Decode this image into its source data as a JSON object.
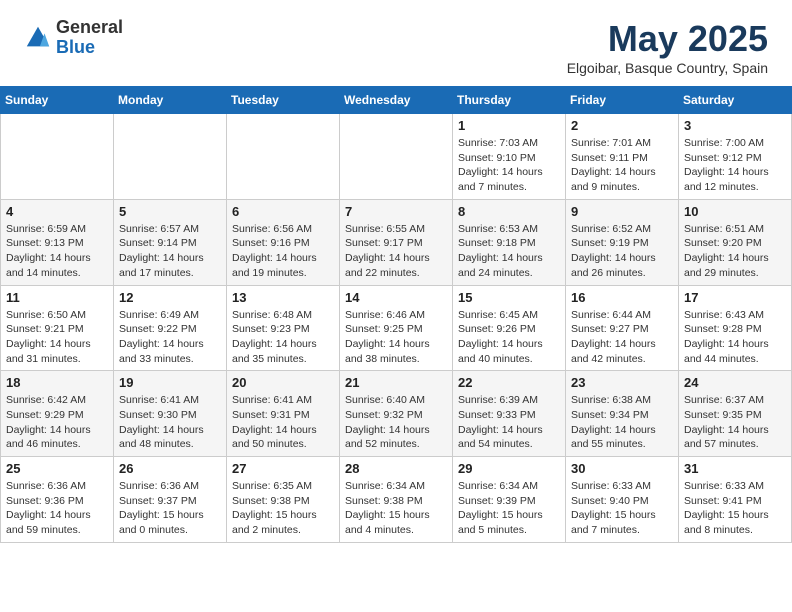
{
  "header": {
    "logo_general": "General",
    "logo_blue": "Blue",
    "title": "May 2025",
    "subtitle": "Elgoibar, Basque Country, Spain"
  },
  "weekdays": [
    "Sunday",
    "Monday",
    "Tuesday",
    "Wednesday",
    "Thursday",
    "Friday",
    "Saturday"
  ],
  "weeks": [
    [
      {
        "day": "",
        "info": ""
      },
      {
        "day": "",
        "info": ""
      },
      {
        "day": "",
        "info": ""
      },
      {
        "day": "",
        "info": ""
      },
      {
        "day": "1",
        "info": "Sunrise: 7:03 AM\nSunset: 9:10 PM\nDaylight: 14 hours\nand 7 minutes."
      },
      {
        "day": "2",
        "info": "Sunrise: 7:01 AM\nSunset: 9:11 PM\nDaylight: 14 hours\nand 9 minutes."
      },
      {
        "day": "3",
        "info": "Sunrise: 7:00 AM\nSunset: 9:12 PM\nDaylight: 14 hours\nand 12 minutes."
      }
    ],
    [
      {
        "day": "4",
        "info": "Sunrise: 6:59 AM\nSunset: 9:13 PM\nDaylight: 14 hours\nand 14 minutes."
      },
      {
        "day": "5",
        "info": "Sunrise: 6:57 AM\nSunset: 9:14 PM\nDaylight: 14 hours\nand 17 minutes."
      },
      {
        "day": "6",
        "info": "Sunrise: 6:56 AM\nSunset: 9:16 PM\nDaylight: 14 hours\nand 19 minutes."
      },
      {
        "day": "7",
        "info": "Sunrise: 6:55 AM\nSunset: 9:17 PM\nDaylight: 14 hours\nand 22 minutes."
      },
      {
        "day": "8",
        "info": "Sunrise: 6:53 AM\nSunset: 9:18 PM\nDaylight: 14 hours\nand 24 minutes."
      },
      {
        "day": "9",
        "info": "Sunrise: 6:52 AM\nSunset: 9:19 PM\nDaylight: 14 hours\nand 26 minutes."
      },
      {
        "day": "10",
        "info": "Sunrise: 6:51 AM\nSunset: 9:20 PM\nDaylight: 14 hours\nand 29 minutes."
      }
    ],
    [
      {
        "day": "11",
        "info": "Sunrise: 6:50 AM\nSunset: 9:21 PM\nDaylight: 14 hours\nand 31 minutes."
      },
      {
        "day": "12",
        "info": "Sunrise: 6:49 AM\nSunset: 9:22 PM\nDaylight: 14 hours\nand 33 minutes."
      },
      {
        "day": "13",
        "info": "Sunrise: 6:48 AM\nSunset: 9:23 PM\nDaylight: 14 hours\nand 35 minutes."
      },
      {
        "day": "14",
        "info": "Sunrise: 6:46 AM\nSunset: 9:25 PM\nDaylight: 14 hours\nand 38 minutes."
      },
      {
        "day": "15",
        "info": "Sunrise: 6:45 AM\nSunset: 9:26 PM\nDaylight: 14 hours\nand 40 minutes."
      },
      {
        "day": "16",
        "info": "Sunrise: 6:44 AM\nSunset: 9:27 PM\nDaylight: 14 hours\nand 42 minutes."
      },
      {
        "day": "17",
        "info": "Sunrise: 6:43 AM\nSunset: 9:28 PM\nDaylight: 14 hours\nand 44 minutes."
      }
    ],
    [
      {
        "day": "18",
        "info": "Sunrise: 6:42 AM\nSunset: 9:29 PM\nDaylight: 14 hours\nand 46 minutes."
      },
      {
        "day": "19",
        "info": "Sunrise: 6:41 AM\nSunset: 9:30 PM\nDaylight: 14 hours\nand 48 minutes."
      },
      {
        "day": "20",
        "info": "Sunrise: 6:41 AM\nSunset: 9:31 PM\nDaylight: 14 hours\nand 50 minutes."
      },
      {
        "day": "21",
        "info": "Sunrise: 6:40 AM\nSunset: 9:32 PM\nDaylight: 14 hours\nand 52 minutes."
      },
      {
        "day": "22",
        "info": "Sunrise: 6:39 AM\nSunset: 9:33 PM\nDaylight: 14 hours\nand 54 minutes."
      },
      {
        "day": "23",
        "info": "Sunrise: 6:38 AM\nSunset: 9:34 PM\nDaylight: 14 hours\nand 55 minutes."
      },
      {
        "day": "24",
        "info": "Sunrise: 6:37 AM\nSunset: 9:35 PM\nDaylight: 14 hours\nand 57 minutes."
      }
    ],
    [
      {
        "day": "25",
        "info": "Sunrise: 6:36 AM\nSunset: 9:36 PM\nDaylight: 14 hours\nand 59 minutes."
      },
      {
        "day": "26",
        "info": "Sunrise: 6:36 AM\nSunset: 9:37 PM\nDaylight: 15 hours\nand 0 minutes."
      },
      {
        "day": "27",
        "info": "Sunrise: 6:35 AM\nSunset: 9:38 PM\nDaylight: 15 hours\nand 2 minutes."
      },
      {
        "day": "28",
        "info": "Sunrise: 6:34 AM\nSunset: 9:38 PM\nDaylight: 15 hours\nand 4 minutes."
      },
      {
        "day": "29",
        "info": "Sunrise: 6:34 AM\nSunset: 9:39 PM\nDaylight: 15 hours\nand 5 minutes."
      },
      {
        "day": "30",
        "info": "Sunrise: 6:33 AM\nSunset: 9:40 PM\nDaylight: 15 hours\nand 7 minutes."
      },
      {
        "day": "31",
        "info": "Sunrise: 6:33 AM\nSunset: 9:41 PM\nDaylight: 15 hours\nand 8 minutes."
      }
    ]
  ]
}
